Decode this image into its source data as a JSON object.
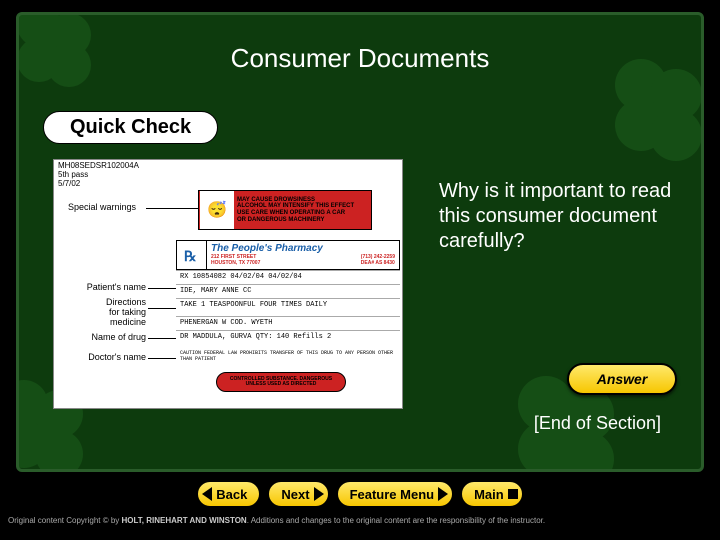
{
  "title": "Consumer Documents",
  "quick_check": "Quick Check",
  "doc": {
    "meta1": "MH08SEDSR102004A",
    "meta2": "5th pass",
    "meta3": "5/7/02",
    "warn_text": "MAY CAUSE DROWSINESS\nALCOHOL MAY INTENSIFY THIS EFFECT\nUSE CARE WHEN OPERATING A CAR\nOR DANGEROUS MACHINERY",
    "label_special": "Special warnings",
    "pharmacy_name": "The People's Pharmacy",
    "pharmacy_addr": "212 FIRST STREET\nHOUSTON, TX 77007",
    "pharmacy_phone": "(713) 242-2259\nDEA# AS 8430",
    "rx_row1": "RX 10854082     04/02/04     04/02/04",
    "rx_row2": "IDE, MARY ANNE                    CC",
    "rx_row3": "TAKE 1 TEASPOONFUL FOUR TIMES DAILY",
    "rx_row4": "PHENERGAN W COD. WYETH",
    "rx_row5": "DR  MADDULA, GURVA   QTY: 140   Refills 2",
    "rx_caution": "CAUTION FEDERAL LAW PROHIBITS TRANSFER OF THIS DRUG TO ANY PERSON OTHER THAN PATIENT",
    "label_patient": "Patient's name",
    "label_directions": "Directions\nfor taking\nmedicine",
    "label_drug": "Name of drug",
    "label_doctor": "Doctor's name",
    "redpill": "CONTROLLED SUBSTANCE. DANGEROUS\nUNLESS USED AS DIRECTED"
  },
  "question": "Why is it important to read this consumer document carefully?",
  "answer_btn": "Answer",
  "end_section": "[End of Section]",
  "nav": {
    "back": "Back",
    "next": "Next",
    "feature": "Feature Menu",
    "main": "Main"
  },
  "copyright_pre": "Original content Copyright © by ",
  "copyright_holder": "HOLT, RINEHART AND WINSTON",
  "copyright_post": ". Additions and changes to the original content are the responsibility of the instructor."
}
